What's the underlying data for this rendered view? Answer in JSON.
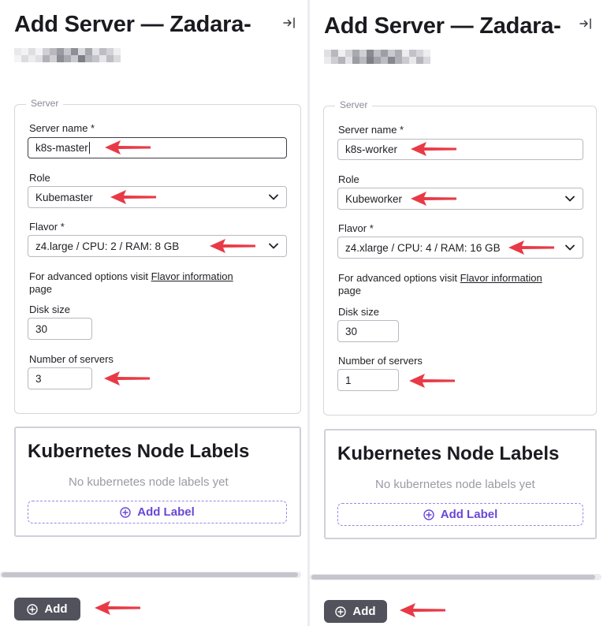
{
  "colors": {
    "arrow": "#e83a46",
    "accent": "#6a47d6",
    "button": "#52525c"
  },
  "panels": [
    {
      "title": "Add Server — Zadara-",
      "legend": "Server",
      "server_name_label": "Server name *",
      "server_name_value": "k8s-master",
      "role_label": "Role",
      "role_value": "Kubemaster",
      "flavor_label": "Flavor *",
      "flavor_value": "z4.large / CPU: 2 / RAM: 8 GB",
      "helper_prefix": "For advanced options visit",
      "helper_link": "Flavor information",
      "helper_suffix": "page",
      "disk_label": "Disk size",
      "disk_value": "30",
      "num_label": "Number of servers",
      "num_value": "3",
      "labels_title": "Kubernetes Node Labels",
      "labels_empty": "No kubernetes node labels yet",
      "add_label": "Add Label",
      "add_button": "Add"
    },
    {
      "title": "Add Server — Zadara-",
      "legend": "Server",
      "server_name_label": "Server name *",
      "server_name_value": "k8s-worker",
      "role_label": "Role",
      "role_value": "Kubeworker",
      "flavor_label": "Flavor *",
      "flavor_value": "z4.xlarge / CPU: 4 / RAM: 16 GB",
      "helper_prefix": "For advanced options visit",
      "helper_link": "Flavor information",
      "helper_suffix": "page",
      "disk_label": "Disk size",
      "disk_value": "30",
      "num_label": "Number of servers",
      "num_value": "1",
      "labels_title": "Kubernetes Node Labels",
      "labels_empty": "No kubernetes node labels yet",
      "add_label": "Add Label",
      "add_button": "Add"
    }
  ]
}
